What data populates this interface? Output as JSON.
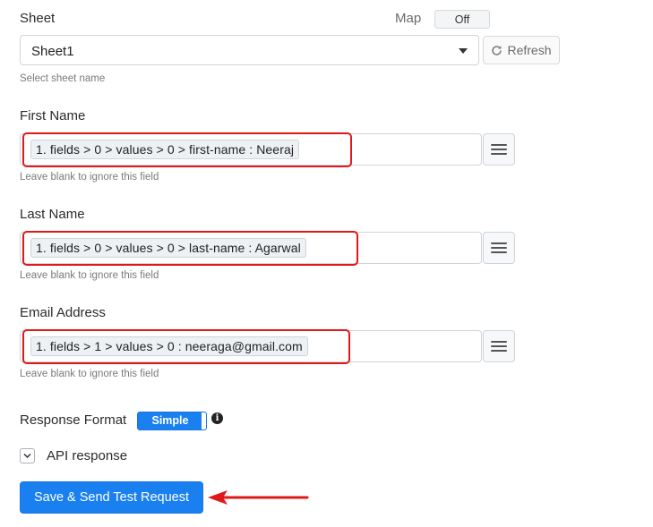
{
  "sheet": {
    "label": "Sheet",
    "map_label": "Map",
    "map_toggle": "Off",
    "selected": "Sheet1",
    "hint": "Select sheet name",
    "refresh_label": "Refresh"
  },
  "fields": [
    {
      "label": "First Name",
      "value": "1. fields > 0 > values > 0 > first-name : Neeraj",
      "hint": "Leave blank to ignore this field"
    },
    {
      "label": "Last Name",
      "value": "1. fields > 0 > values > 0 > last-name : Agarwal",
      "hint": "Leave blank to ignore this field"
    },
    {
      "label": "Email Address",
      "value": "1. fields > 1 > values > 0 : neeraga@gmail.com",
      "hint": "Leave blank to ignore this field"
    }
  ],
  "response": {
    "label": "Response Format",
    "toggle": "Simple",
    "info_icon": "i"
  },
  "api_response_label": "API response",
  "submit_label": "Save & Send Test Request",
  "colors": {
    "accent": "#1a80f0",
    "highlight": "#e01818"
  }
}
